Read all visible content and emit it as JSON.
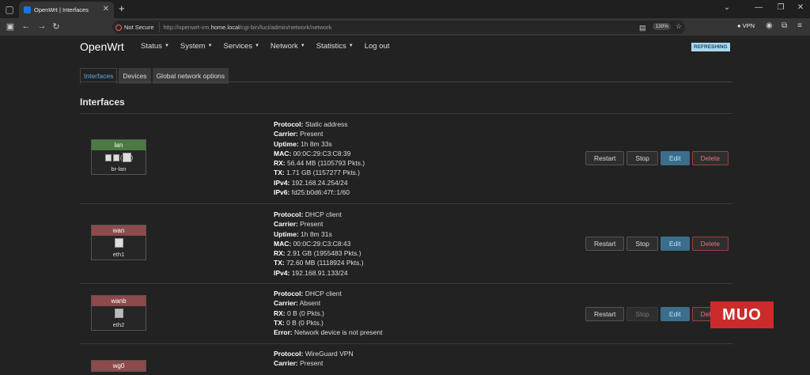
{
  "browser": {
    "tab_title": "OpenWrt | Interfaces",
    "new_tab_symbol": "+",
    "security_label": "Not Secure",
    "url_prefix": "http://openwrt-vm.",
    "url_host": "home.local",
    "url_path": "/cgi-bin/luci/admin/network/network",
    "zoom": "130%",
    "vpn_label": "VPN"
  },
  "header": {
    "brand": "OpenWrt",
    "menu": [
      "Status",
      "System",
      "Services",
      "Network",
      "Statistics",
      "Log out"
    ],
    "status_badge": "REFRESHING"
  },
  "subtabs": [
    "Interfaces",
    "Devices",
    "Global network options"
  ],
  "section_title": "Interfaces",
  "buttons": {
    "restart": "Restart",
    "stop": "Stop",
    "edit": "Edit",
    "delete": "Delete"
  },
  "labels": {
    "protocol": "Protocol:",
    "carrier": "Carrier:",
    "uptime": "Uptime:",
    "mac": "MAC:",
    "rx": "RX:",
    "tx": "TX:",
    "ipv4": "IPv4:",
    "ipv6": "IPv6:",
    "error": "Error:"
  },
  "interfaces": [
    {
      "name": "lan",
      "color": "#4c7a43",
      "device": "br-lan",
      "protocol": "Static address",
      "carrier": "Present",
      "uptime": "1h 8m 33s",
      "mac": "00:0C:29:C3:C8:39",
      "rx": "56.44 MB (1105793 Pkts.)",
      "tx": "1.71 GB (1157277 Pkts.)",
      "ipv4": "192.168.24.254/24",
      "ipv6": "fd25:b0d6:47f::1/60"
    },
    {
      "name": "wan",
      "color": "#8c4a4a",
      "device": "eth1",
      "protocol": "DHCP client",
      "carrier": "Present",
      "uptime": "1h 8m 31s",
      "mac": "00:0C:29:C3:C8:43",
      "rx": "2.91 GB (1955483 Pkts.)",
      "tx": "72.60 MB (1118924 Pkts.)",
      "ipv4": "192.168.91.133/24"
    },
    {
      "name": "wanb",
      "color": "#8c4a4a",
      "device": "eth2",
      "protocol": "DHCP client",
      "carrier": "Absent",
      "rx": "0 B (0 Pkts.)",
      "tx": "0 B (0 Pkts.)",
      "error": "Network device is not present"
    },
    {
      "name": "wg0",
      "color": "#8c4a4a",
      "protocol": "WireGuard VPN",
      "carrier": "Present"
    }
  ],
  "watermark": "MUO"
}
